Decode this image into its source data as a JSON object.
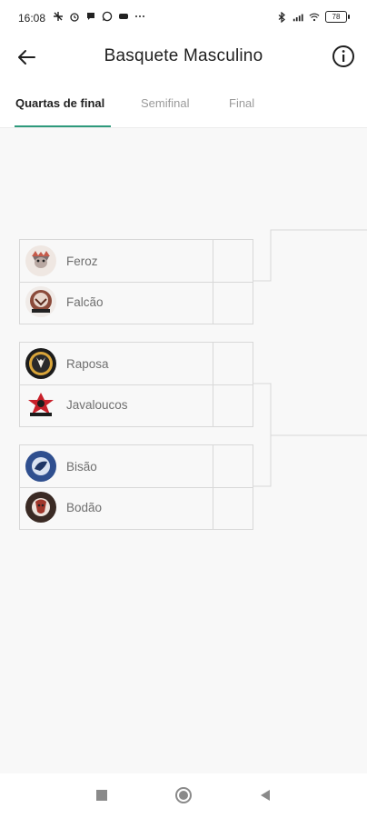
{
  "status_bar": {
    "time": "16:08",
    "battery": "78",
    "left_icons": [
      "airplane-off-icon",
      "alarm-icon",
      "chat-icon",
      "whatsapp-icon",
      "game-icon",
      "more-icon"
    ],
    "right_icons": [
      "bluetooth-icon",
      "signal-icon",
      "wifi-icon",
      "battery-icon"
    ]
  },
  "header": {
    "title": "Basquete Masculino",
    "back_icon": "arrow-left-icon",
    "info_icon": "info-icon"
  },
  "tabs": [
    {
      "label": "Quartas de final",
      "active": true
    },
    {
      "label": "Semifinal",
      "active": false
    },
    {
      "label": "Final",
      "active": false
    }
  ],
  "bracket": {
    "matches": [
      {
        "teams": [
          {
            "name": "Feroz",
            "icon": "feroz-logo-icon"
          },
          {
            "name": "Falcão",
            "icon": "falcao-logo-icon"
          }
        ]
      },
      {
        "teams": [
          {
            "name": "Raposa",
            "icon": "raposa-logo-icon"
          },
          {
            "name": "Javaloucos",
            "icon": "javaloucos-logo-icon"
          }
        ]
      },
      {
        "teams": [
          {
            "name": "Bisão",
            "icon": "bisao-logo-icon"
          },
          {
            "name": "Bodão",
            "icon": "bodao-logo-icon"
          }
        ]
      }
    ]
  },
  "colors": {
    "tab_indicator": "#2e9a7c",
    "background": "#f8f8f8"
  }
}
